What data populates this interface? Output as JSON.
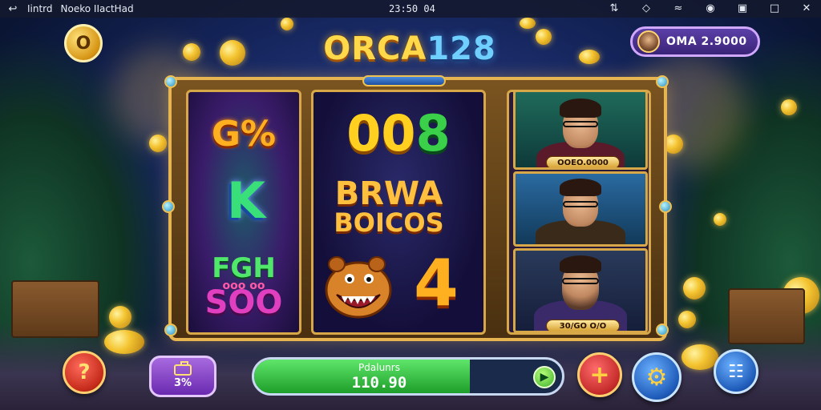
{
  "status_bar": {
    "left_text_1": "Iintrd",
    "left_text_2": "Noeko IIactHad",
    "center_time": "23:50 04",
    "icons": [
      "arrow-left-icon",
      "signal-icon",
      "bluetooth-icon",
      "wifi-icon",
      "record-icon",
      "cast-icon",
      "window-icon",
      "close-icon"
    ]
  },
  "logo": {
    "word": "ORCA",
    "number": "128"
  },
  "top_left_button": {
    "label": "O"
  },
  "balance": {
    "text": "OMA 2.9000"
  },
  "reels": {
    "reel1": {
      "symbol_top": "G%",
      "symbol_mid": "K",
      "symbol_bottom_line1": "FGH",
      "symbol_bottom_line2": "ooo oo",
      "symbol_bottom_line3": "SOO"
    },
    "reel2": {
      "symbol_top_a": "00",
      "symbol_top_b": "8",
      "symbol_mid_line1": "BRWA",
      "symbol_mid_line2": "BOICOS",
      "symbol_bottom": "4"
    },
    "reel3": {
      "portrait_1_label": "OOEO.0000",
      "portrait_2_label": "",
      "portrait_3_label": "30/GO O/O"
    }
  },
  "controls": {
    "help_label": "?",
    "bet_value": "3%",
    "spin_label": "Pdalunrs",
    "spin_value": "110.90",
    "spin_progress": 0.7,
    "go_label": "▶",
    "plus_label": "+",
    "settings_icon": "gear-icon",
    "menu_label": "☷"
  },
  "colors": {
    "frame_gold": "#e6b450",
    "spin_green": "#1e9e2a",
    "balance_purple": "#3a2478"
  }
}
